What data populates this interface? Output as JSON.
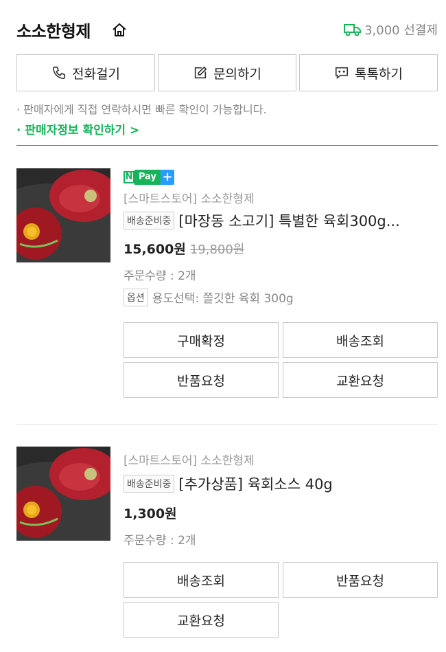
{
  "header": {
    "store_name": "소소한형제",
    "shipping_text": "3,000 선결제",
    "home_icon": "home-icon",
    "truck_icon": "truck-icon"
  },
  "actions": [
    {
      "label": "전화걸기",
      "icon": "phone-icon"
    },
    {
      "label": "문의하기",
      "icon": "edit-icon"
    },
    {
      "label": "톡톡하기",
      "icon": "chat-icon"
    }
  ],
  "notice": "· 판매자에게 직접 연락하시면 빠른 확인이 가능합니다.",
  "seller_info_link": "· 판매자정보 확인하기 >",
  "orders": [
    {
      "npay": {
        "n": "N",
        "pay": "Pay",
        "plus": "+"
      },
      "store": "[스마트스토어] 소소한형제",
      "status_badge": "배송준비중",
      "title": "[마장동 소고기] 특별한 육회300g...",
      "price": "15,600원",
      "original_price": "19,800원",
      "quantity": "주문수량 : 2개",
      "option_badge": "옵션",
      "option_text": "용도선택: 쫄깃한 육회 300g",
      "buttons": [
        "구매확정",
        "배송조회",
        "반품요청",
        "교환요청"
      ]
    },
    {
      "store": "[스마트스토어] 소소한형제",
      "status_badge": "배송준비중",
      "title": "[추가상품] 육회소스 40g",
      "price": "1,300원",
      "quantity": "주문수량 : 2개",
      "buttons": [
        "배송조회",
        "반품요청",
        "교환요청"
      ]
    }
  ],
  "colors": {
    "accent": "#17b35a",
    "npay_plus": "#2b9cff"
  }
}
